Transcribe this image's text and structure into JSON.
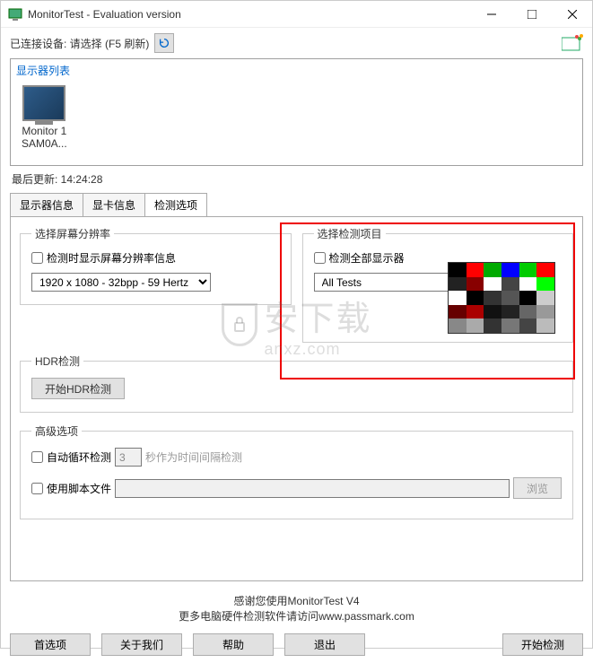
{
  "window": {
    "title": "MonitorTest - Evaluation version"
  },
  "device_row": {
    "label": "已连接设备: 请选择 (F5 刷新)"
  },
  "panel": {
    "title": "显示器列表",
    "monitor_line1": "Monitor 1",
    "monitor_line2": "SAM0A..."
  },
  "last_update": "最后更新: 14:24:28",
  "tabs": {
    "t1": "显示器信息",
    "t2": "显卡信息",
    "t3": "检测选项"
  },
  "resolution": {
    "legend": "选择屏幕分辨率",
    "checkbox": "检测时显示屏幕分辨率信息",
    "selected": "1920 x 1080 - 32bpp - 59 Hertz"
  },
  "tests": {
    "legend": "选择检测项目",
    "checkbox": "检测全部显示器",
    "selected": "All Tests"
  },
  "hdr": {
    "legend": "HDR检测",
    "button": "开始HDR检测"
  },
  "advanced": {
    "legend": "高级选项",
    "autoloop": "自动循环检测",
    "autoloop_value": "3",
    "autoloop_hint": "秒作为时间间隔检测",
    "script": "使用脚本文件",
    "browse": "浏览"
  },
  "footer": {
    "line1": "感谢您使用MonitorTest V4",
    "line2": "更多电脑硬件检测软件请访问www.passmark.com"
  },
  "buttons": {
    "prefs": "首选项",
    "about": "关于我们",
    "help": "帮助",
    "exit": "退出",
    "start": "开始检测"
  },
  "watermark": "安下载",
  "watermark_sub": "anxz.com"
}
